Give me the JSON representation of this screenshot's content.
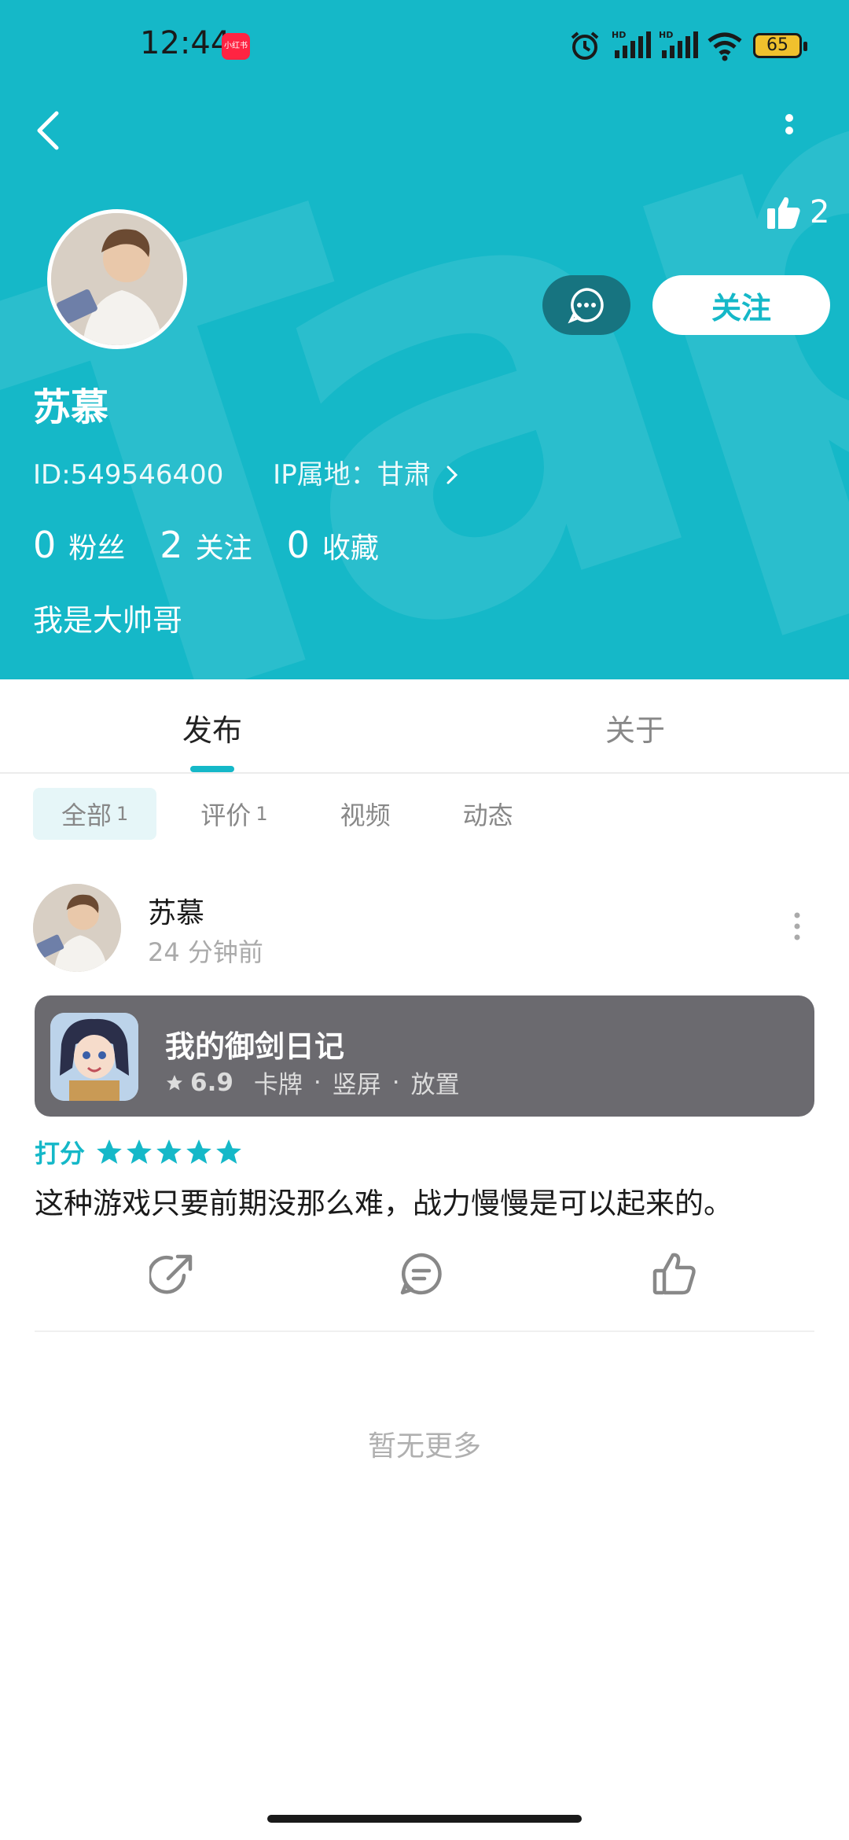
{
  "status_bar": {
    "time": "12:44",
    "app_badge": "小红书",
    "battery": "65"
  },
  "profile": {
    "likes": "2",
    "follow_label": "关注",
    "name": "苏慕",
    "id_text": "ID:549546400",
    "ip_text": "IP属地：甘肃",
    "stats": [
      {
        "num": "0",
        "label": "粉丝"
      },
      {
        "num": "2",
        "label": "关注"
      },
      {
        "num": "0",
        "label": "收藏"
      }
    ],
    "bio": "我是大帅哥"
  },
  "tabs": {
    "publish": "发布",
    "about": "关于"
  },
  "chips": [
    {
      "label": "全部",
      "count": "1"
    },
    {
      "label": "评价",
      "count": "1"
    },
    {
      "label": "视频",
      "count": ""
    },
    {
      "label": "动态",
      "count": ""
    }
  ],
  "post": {
    "author": "苏慕",
    "time": "24 分钟前",
    "game": {
      "title": "我的御剑日记",
      "score": "6.9",
      "tags": [
        "卡牌",
        "竖屏",
        "放置"
      ]
    },
    "rating_label": "打分",
    "rating_stars": 5,
    "review": "这种游戏只要前期没那么难，战力慢慢是可以起来的。"
  },
  "footer": {
    "no_more": "暂无更多"
  },
  "colors": {
    "accent": "#15b8c8",
    "card": "#6b6a6f",
    "message_button": "#177480"
  }
}
